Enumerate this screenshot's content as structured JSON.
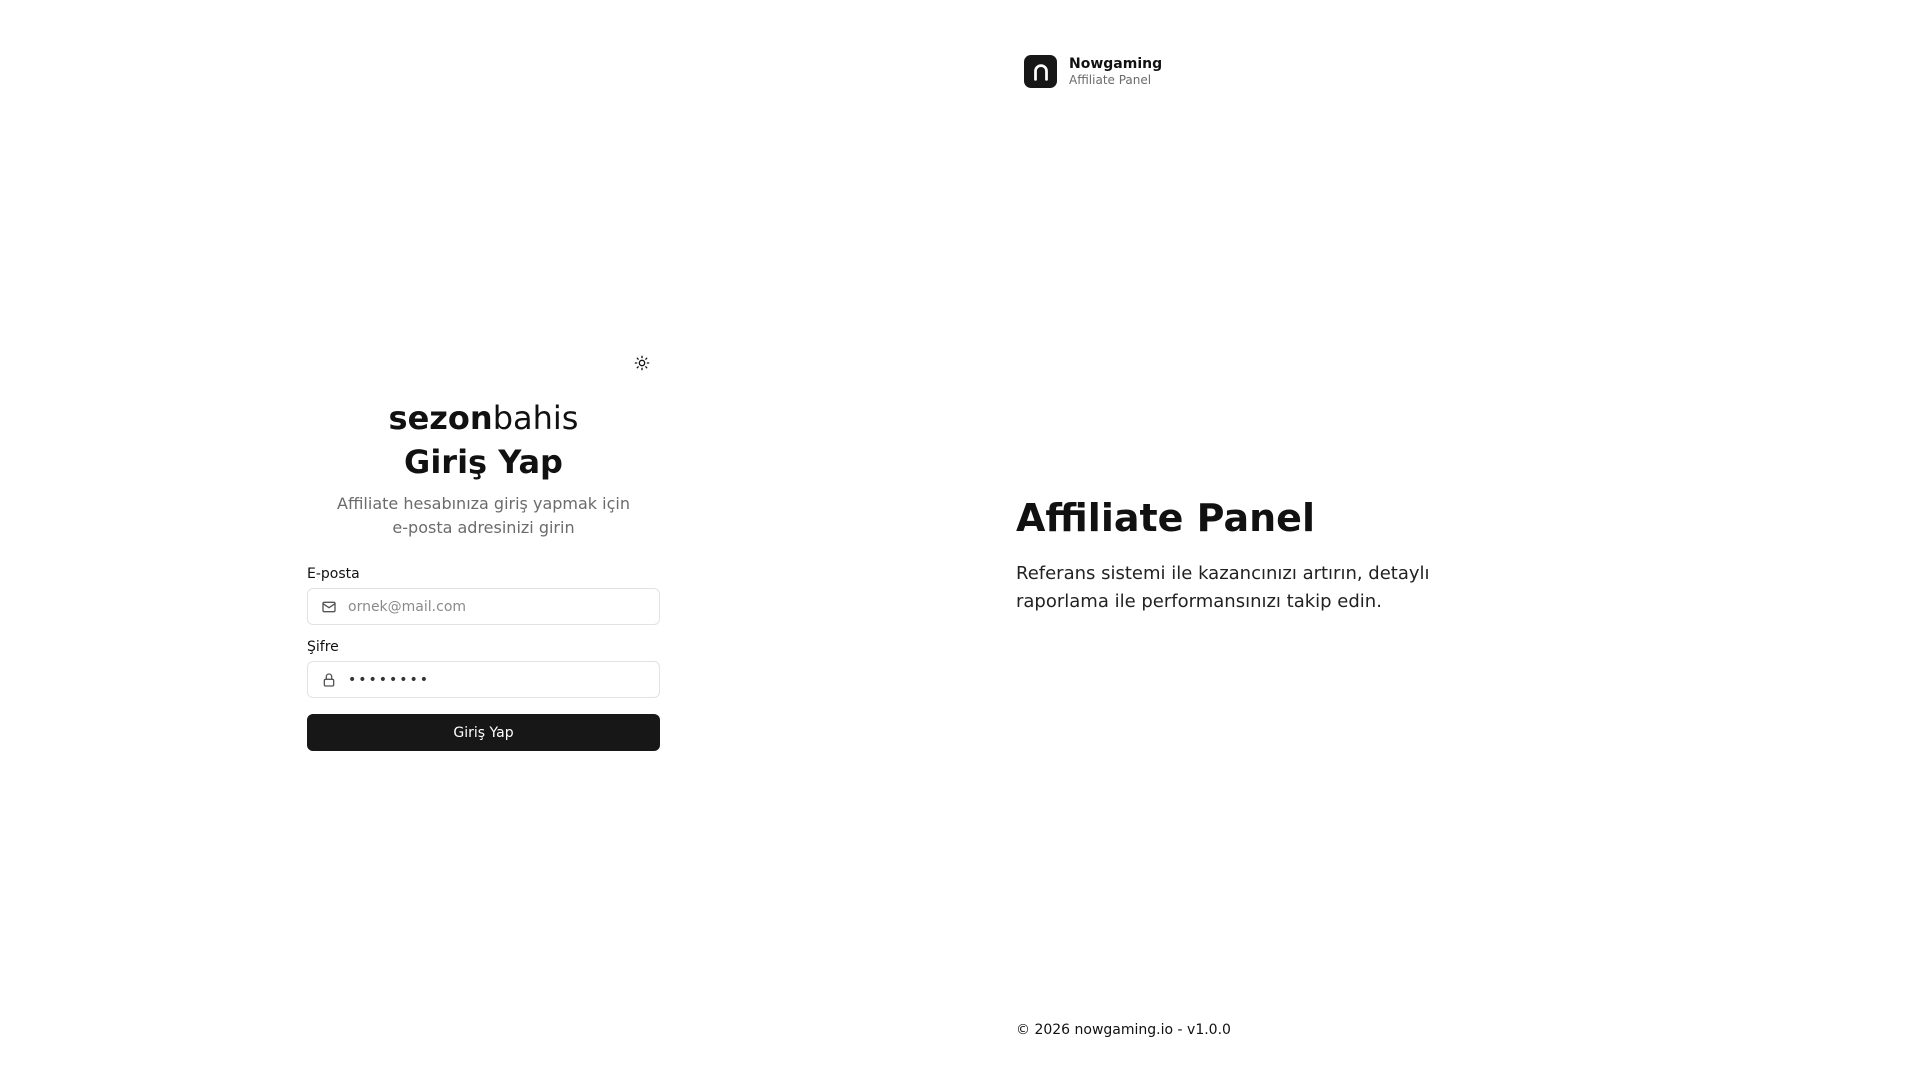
{
  "brand": {
    "part1": "sezon",
    "part2": "bahis"
  },
  "login": {
    "title": "Giriş Yap",
    "subtitle": "Affiliate hesabınıza giriş yapmak için e-posta adresinizi girin",
    "email_label": "E-posta",
    "email_placeholder": "ornek@mail.com",
    "password_label": "Şifre",
    "password_value": "••••••••",
    "submit_label": "Giriş Yap"
  },
  "logo": {
    "name": "Nowgaming",
    "sub": "Affiliate Panel"
  },
  "hero": {
    "title": "Affiliate Panel",
    "text": "Referans sistemi ile kazancınızı artırın, detaylı raporlama ile performansınızı takip edin."
  },
  "footer": {
    "text": "© 2026 nowgaming.io - v1.0.0"
  },
  "icons": {
    "theme": "sun-icon",
    "email": "mail-icon",
    "password": "lock-icon",
    "logo": "arch-logo-icon"
  },
  "colors": {
    "primary": "#171717",
    "muted": "#6b6b6b",
    "border": "#e2e2e2"
  }
}
